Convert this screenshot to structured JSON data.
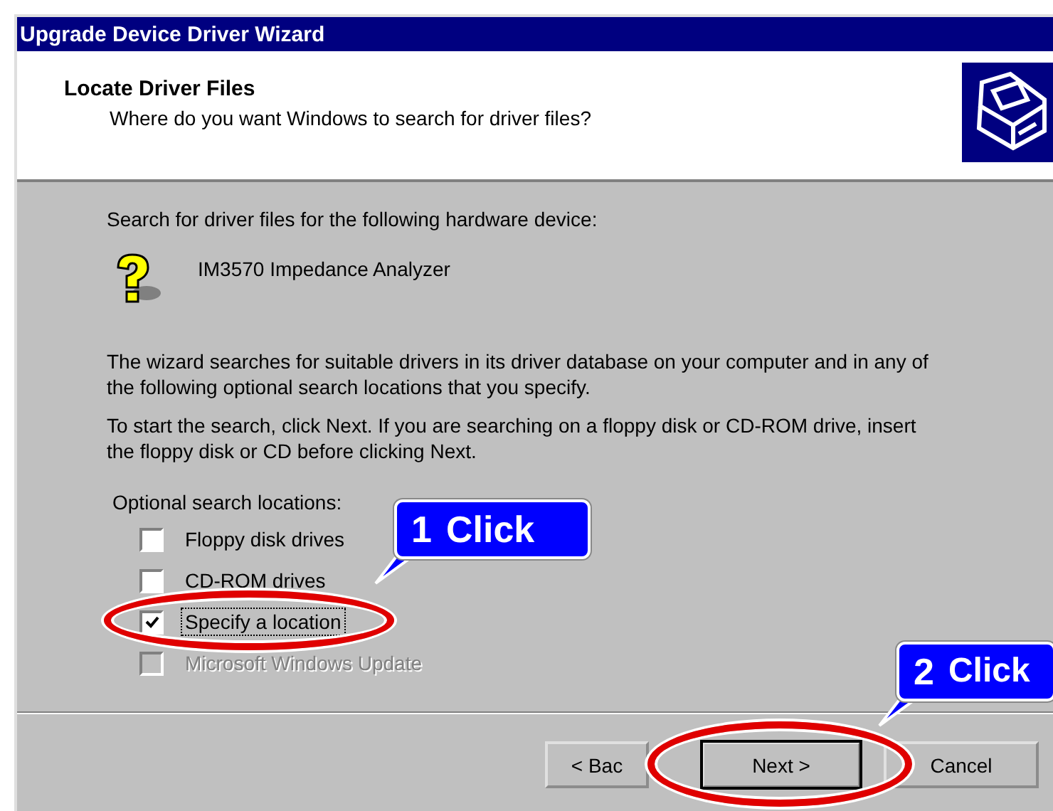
{
  "window": {
    "title": "Upgrade Device Driver Wizard"
  },
  "header": {
    "title": "Locate Driver Files",
    "subtitle": "Where do you want Windows to search for driver files?"
  },
  "intro": "Search for driver files for the following hardware device:",
  "device": {
    "name": "IM3570 Impedance Analyzer"
  },
  "paragraphs": [
    "The wizard searches for suitable drivers in its driver database on your computer and in any of the following optional search locations that you specify.",
    "To start the search, click Next. If you are searching on a floppy disk or CD-ROM drive, insert the floppy disk or CD before clicking Next."
  ],
  "options_label": "Optional search locations:",
  "options": [
    {
      "label": "Floppy disk drives",
      "checked": false,
      "disabled": false,
      "focused": false
    },
    {
      "label": "CD-ROM drives",
      "checked": false,
      "disabled": false,
      "focused": false
    },
    {
      "label": "Specify a location",
      "checked": true,
      "disabled": false,
      "focused": true
    },
    {
      "label": "Microsoft Windows Update",
      "checked": false,
      "disabled": true,
      "focused": false
    }
  ],
  "buttons": [
    {
      "label": "< Bac",
      "default": false
    },
    {
      "label": "Next >",
      "default": true
    },
    {
      "label": "Cancel",
      "default": false
    }
  ],
  "callouts": [
    {
      "number": "1",
      "text": "Click"
    },
    {
      "number": "2",
      "text": "Click"
    }
  ]
}
